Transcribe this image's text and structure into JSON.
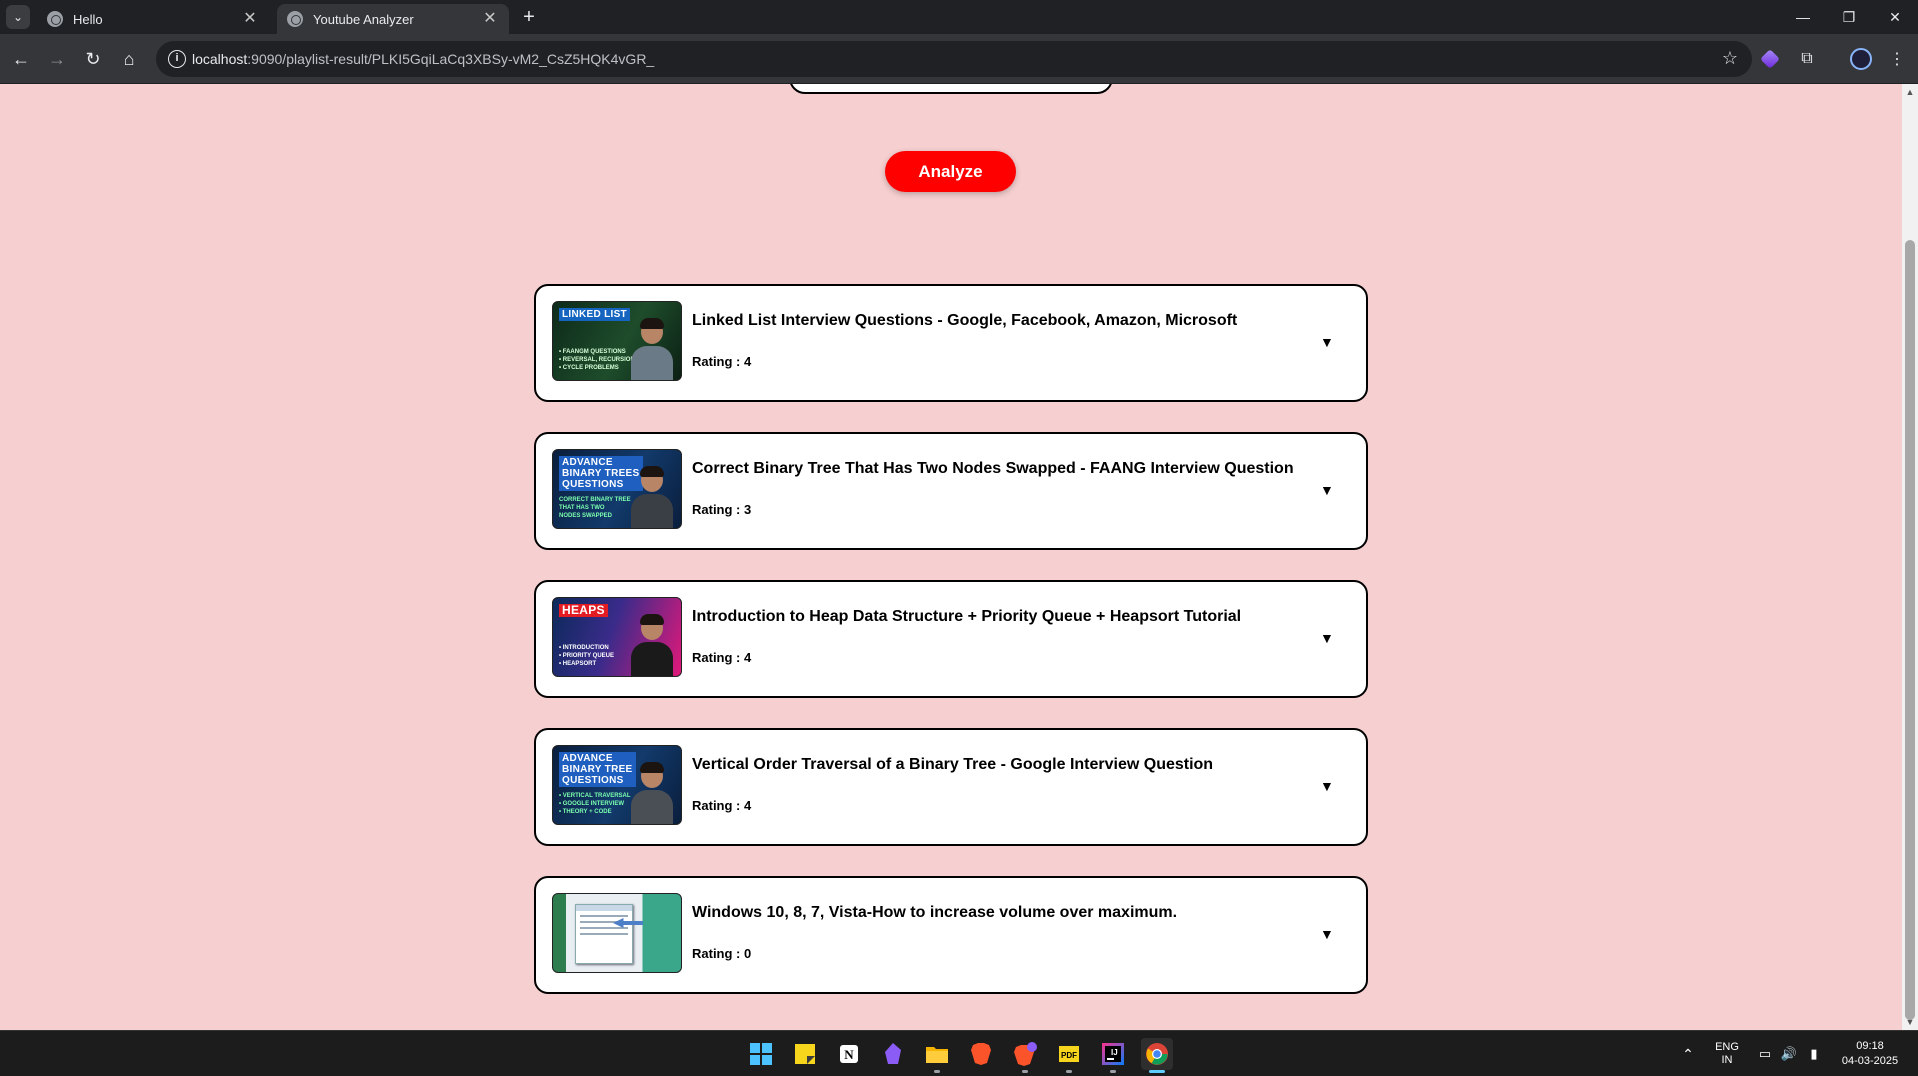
{
  "browser": {
    "tabs": [
      {
        "title": "Hello",
        "active": false
      },
      {
        "title": "Youtube Analyzer",
        "active": true
      }
    ],
    "url_host": "localhost",
    "url_rest": ":9090/playlist-result/PLKI5GqiLaCq3XBSy-vM2_CsZ5HQK4vGR_"
  },
  "page": {
    "analyze_label": "Analyze",
    "rating_prefix": "Rating : ",
    "videos": [
      {
        "title": "Linked List Interview Questions - Google, Facebook, Amazon, Microsoft",
        "rating": "4",
        "thumb_tag": "LINKED LIST",
        "thumb_lines": "• FAANGM QUESTIONS\n• REVERSAL, RECURSION\n• CYCLE PROBLEMS"
      },
      {
        "title": "Correct Binary Tree That Has Two Nodes Swapped - FAANG Interview Question",
        "rating": "3",
        "thumb_tag": "ADVANCE\nBINARY TREES\nQUESTIONS",
        "thumb_lines": "CORRECT BINARY TREE\nTHAT HAS TWO\nNODES SWAPPED"
      },
      {
        "title": "Introduction to Heap Data Structure + Priority Queue + Heapsort Tutorial",
        "rating": "4",
        "thumb_tag": "HEAPS",
        "thumb_lines": "• INTRODUCTION\n• PRIORITY QUEUE\n• HEAPSORT"
      },
      {
        "title": "Vertical Order Traversal of a Binary Tree - Google Interview Question",
        "rating": "4",
        "thumb_tag": "ADVANCE\nBINARY TREE\nQUESTIONS",
        "thumb_lines": "• VERTICAL TRAVERSAL\n• GOOGLE INTERVIEW\n• THEORY + CODE"
      },
      {
        "title": "Windows 10, 8, 7, Vista-How to increase volume over maximum.",
        "rating": "0",
        "thumb_tag": "",
        "thumb_lines": ""
      }
    ],
    "expand_glyph": "▼"
  },
  "taskbar": {
    "lang": "ENG",
    "region": "IN",
    "time": "09:18",
    "date": "04-03-2025"
  },
  "colors": {
    "page_bg": "#f6cfd0",
    "accent": "#ff0000"
  }
}
